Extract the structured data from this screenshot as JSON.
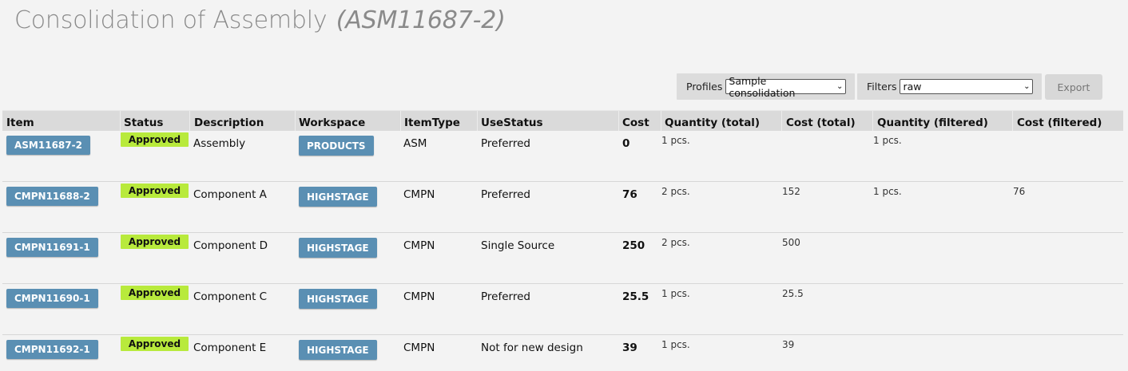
{
  "page": {
    "title": "Consolidation of Assembly",
    "title_code": "(ASM11687-2)"
  },
  "toolbar": {
    "profiles_label": "Profiles",
    "profiles_value": "Sample consolidation",
    "filters_label": "Filters",
    "filters_value": "raw",
    "export_label": "Export"
  },
  "table": {
    "headers": [
      "Item",
      "Status",
      "Description",
      "Workspace",
      "ItemType",
      "UseStatus",
      "Cost",
      "Quantity (total)",
      "Cost (total)",
      "Quantity (filtered)",
      "Cost (filtered)"
    ],
    "rows": [
      {
        "item": "ASM11687-2",
        "status": "Approved",
        "description": "Assembly",
        "workspace": "PRODUCTS",
        "itemtype": "ASM",
        "usestatus": "Preferred",
        "cost": "0",
        "qty_total": "1 pcs.",
        "cost_total": "",
        "qty_filtered": "1 pcs.",
        "cost_filtered": ""
      },
      {
        "item": "CMPN11688-2",
        "status": "Approved",
        "description": "Component A",
        "workspace": "HIGHSTAGE",
        "itemtype": "CMPN",
        "usestatus": "Preferred",
        "cost": "76",
        "qty_total": "2 pcs.",
        "cost_total": "152",
        "qty_filtered": "1 pcs.",
        "cost_filtered": "76"
      },
      {
        "item": "CMPN11691-1",
        "status": "Approved",
        "description": "Component D",
        "workspace": "HIGHSTAGE",
        "itemtype": "CMPN",
        "usestatus": "Single Source",
        "cost": "250",
        "qty_total": "2 pcs.",
        "cost_total": "500",
        "qty_filtered": "",
        "cost_filtered": ""
      },
      {
        "item": "CMPN11690-1",
        "status": "Approved",
        "description": "Component C",
        "workspace": "HIGHSTAGE",
        "itemtype": "CMPN",
        "usestatus": "Preferred",
        "cost": "25.5",
        "qty_total": "1 pcs.",
        "cost_total": "25.5",
        "qty_filtered": "",
        "cost_filtered": ""
      },
      {
        "item": "CMPN11692-1",
        "status": "Approved",
        "description": "Component E",
        "workspace": "HIGHSTAGE",
        "itemtype": "CMPN",
        "usestatus": "Not for new design",
        "cost": "39",
        "qty_total": "1 pcs.",
        "cost_total": "39",
        "qty_filtered": "",
        "cost_filtered": ""
      }
    ]
  },
  "colors": {
    "button_blue": "#5a8fb3",
    "approved_green": "#b8ea3c",
    "header_gray": "#dadada"
  }
}
